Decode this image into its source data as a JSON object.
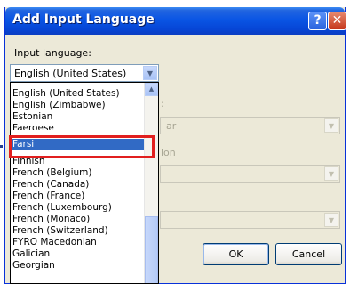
{
  "window": {
    "title": "Add Input Language",
    "help_glyph": "?",
    "close_glyph": "✕"
  },
  "input_language": {
    "label": "Input language:",
    "selected_value": "English (United States)",
    "options": [
      "English (United States)",
      "English (Zimbabwe)",
      "Estonian",
      "Faeroese",
      "Farsi",
      "Finnish",
      "French (Belgium)",
      "French (Canada)",
      "French (France)",
      "French (Luxembourg)",
      "French (Monaco)",
      "French (Switzerland)",
      "FYRO Macedonian",
      "Galician",
      "Georgian"
    ],
    "highlighted_option": "Farsi"
  },
  "background_fields": {
    "label_1_fragment": ":",
    "field_1_fragment": "ar",
    "label_2_fragment": "ion"
  },
  "buttons": {
    "ok": "OK",
    "cancel": "Cancel"
  },
  "colors": {
    "selection": "#316ac5",
    "highlight_box": "#e11f1f",
    "title_bar": "#0a55e4"
  }
}
